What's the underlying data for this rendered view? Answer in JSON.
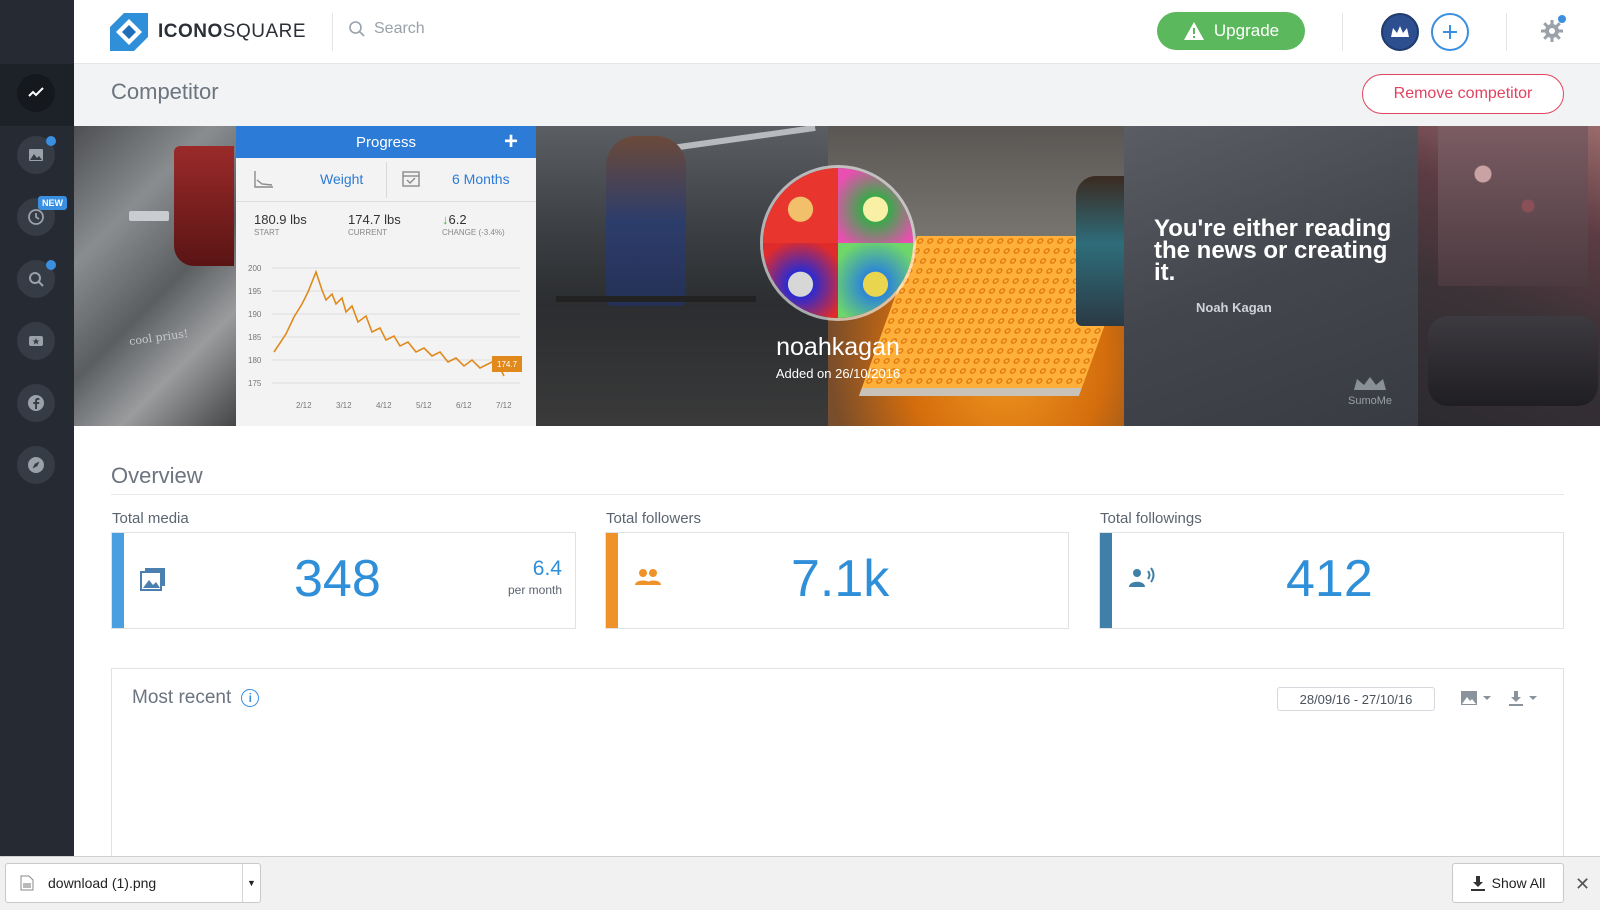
{
  "app": {
    "brand_prefix": "ICONO",
    "brand_suffix": "SQUARE",
    "accent": "#3b8fe0"
  },
  "sidebar": {
    "items": [
      {
        "icon": "analytics-icon",
        "active": true
      },
      {
        "icon": "media-icon",
        "badge_dot": true
      },
      {
        "icon": "clock-icon",
        "badge": "NEW"
      },
      {
        "icon": "search-icon",
        "badge_dot": true
      },
      {
        "icon": "ticket-icon"
      },
      {
        "icon": "facebook-icon"
      },
      {
        "icon": "compass-icon"
      }
    ]
  },
  "topbar": {
    "search_placeholder": "Search",
    "upgrade_label": "Upgrade"
  },
  "page": {
    "title": "Competitor",
    "remove_label": "Remove competitor"
  },
  "banner": {
    "username": "noahkagan",
    "added_on": "Added on 26/10/2016",
    "car_sticker": "cool prius!",
    "progress": {
      "header": "Progress",
      "tab_weight": "Weight",
      "tab_period": "6 Months",
      "start_value": "180.9 lbs",
      "start_label": "START",
      "current_value": "174.7 lbs",
      "current_label": "CURRENT",
      "change_value": "6.2",
      "change_label": "CHANGE (-3.4%)",
      "y_ticks": [
        "200",
        "195",
        "190",
        "185",
        "180",
        "175"
      ],
      "x_ticks": [
        "2/12",
        "3/12",
        "4/12",
        "5/12",
        "6/12",
        "7/12"
      ],
      "last_label": "174.7"
    },
    "quote": "You're either reading the news or creating it.",
    "quote_author": "Noah Kagan",
    "sumo_label": "SumoMe"
  },
  "overview": {
    "title": "Overview",
    "stats": [
      {
        "label": "Total media",
        "value": "348",
        "rate": "6.4",
        "rate_unit": "per month",
        "color": "#4a9fe0"
      },
      {
        "label": "Total followers",
        "value": "7.1k",
        "color": "#f0922a"
      },
      {
        "label": "Total followings",
        "value": "412",
        "color": "#3f7fa8"
      }
    ]
  },
  "recent": {
    "title": "Most recent",
    "date_range": "28/09/16 - 27/10/16"
  },
  "downloads": {
    "file_name": "download (1).png",
    "show_all_label": "Show All"
  }
}
